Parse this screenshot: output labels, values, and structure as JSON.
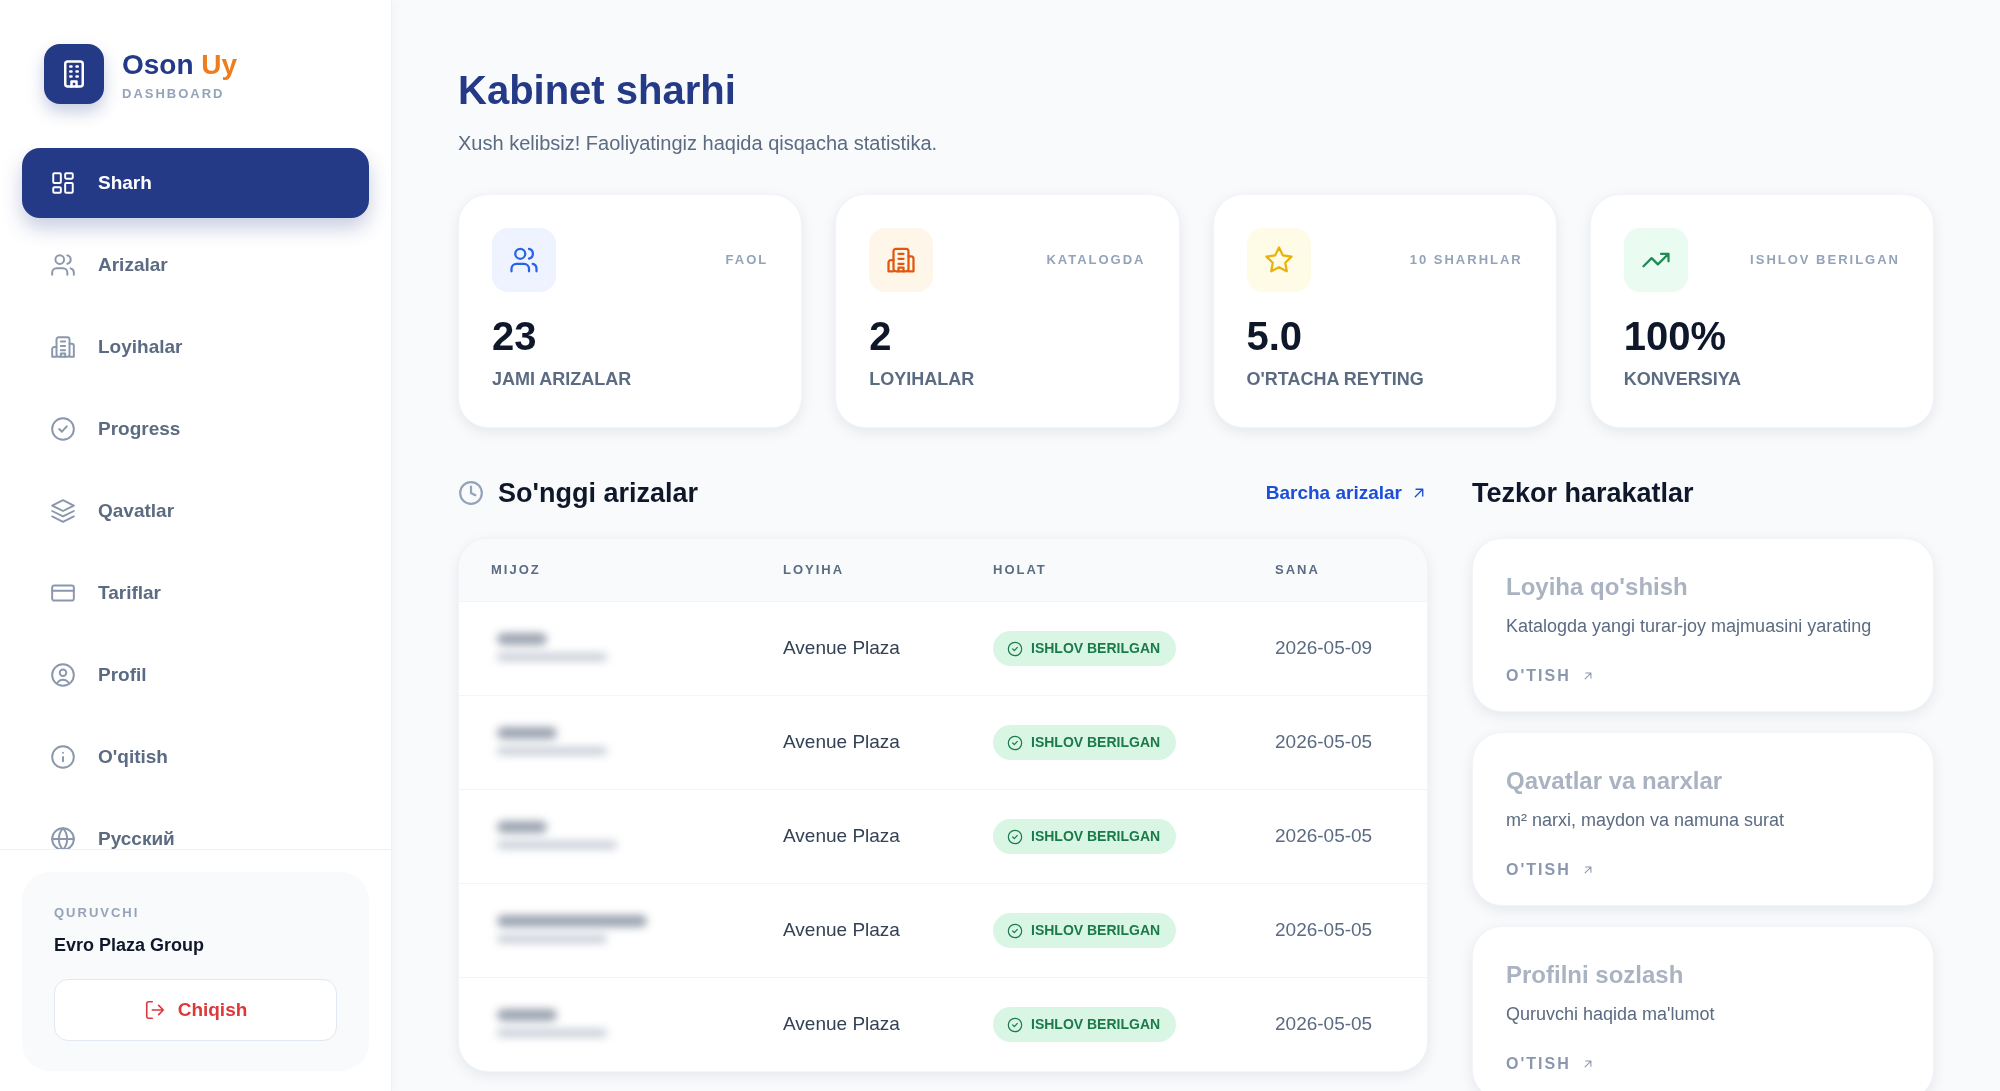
{
  "brand": {
    "name": "Oson",
    "accent": "Uy",
    "subtitle": "DASHBOARD"
  },
  "nav": [
    {
      "label": "Sharh",
      "selected": true
    },
    {
      "label": "Arizalar",
      "selected": false
    },
    {
      "label": "Loyihalar",
      "selected": false
    },
    {
      "label": "Progress",
      "selected": false
    },
    {
      "label": "Qavatlar",
      "selected": false
    },
    {
      "label": "Tariflar",
      "selected": false
    },
    {
      "label": "Profil",
      "selected": false
    },
    {
      "label": "O'qitish",
      "selected": false
    },
    {
      "label": "Русский",
      "selected": false
    }
  ],
  "account": {
    "role": "QURUVCHI",
    "name": "Evro Plaza Group",
    "logout": "Chiqish"
  },
  "header": {
    "title": "Kabinet sharhi",
    "subtitle": "Xush kelibsiz! Faoliyatingiz haqida qisqacha statistika."
  },
  "stats": [
    {
      "tag": "FAOL",
      "value": "23",
      "label": "JAMI ARIZALAR"
    },
    {
      "tag": "KATALOGDA",
      "value": "2",
      "label": "LOYIHALAR"
    },
    {
      "tag": "10 SHARHLAR",
      "value": "5.0",
      "label": "O'RTACHA REYTING"
    },
    {
      "tag": "ISHLOV BERILGAN",
      "value": "100%",
      "label": "KONVERSIYA"
    }
  ],
  "recent": {
    "title": "So'nggi arizalar",
    "link": "Barcha arizalar",
    "columns": [
      "MIJOZ",
      "LOYIHA",
      "HOLAT",
      "SANA"
    ],
    "rows": [
      {
        "project": "Avenue Plaza",
        "status": "ISHLOV BERILGAN",
        "date": "2026-05-09"
      },
      {
        "project": "Avenue Plaza",
        "status": "ISHLOV BERILGAN",
        "date": "2026-05-05"
      },
      {
        "project": "Avenue Plaza",
        "status": "ISHLOV BERILGAN",
        "date": "2026-05-05"
      },
      {
        "project": "Avenue Plaza",
        "status": "ISHLOV BERILGAN",
        "date": "2026-05-05"
      },
      {
        "project": "Avenue Plaza",
        "status": "ISHLOV BERILGAN",
        "date": "2026-05-05"
      }
    ]
  },
  "quick": {
    "title": "Tezkor harakatlar",
    "items": [
      {
        "title": "Loyiha qo'shish",
        "description": "Katalogda yangi turar-joy majmuasini yarating",
        "link": "O'TISH"
      },
      {
        "title": "Qavatlar va narxlar",
        "description": "m² narxi, maydon va namuna surat",
        "link": "O'TISH"
      },
      {
        "title": "Profilni sozlash",
        "description": "Quruvchi haqida ma'lumot",
        "link": "O'TISH"
      }
    ]
  }
}
